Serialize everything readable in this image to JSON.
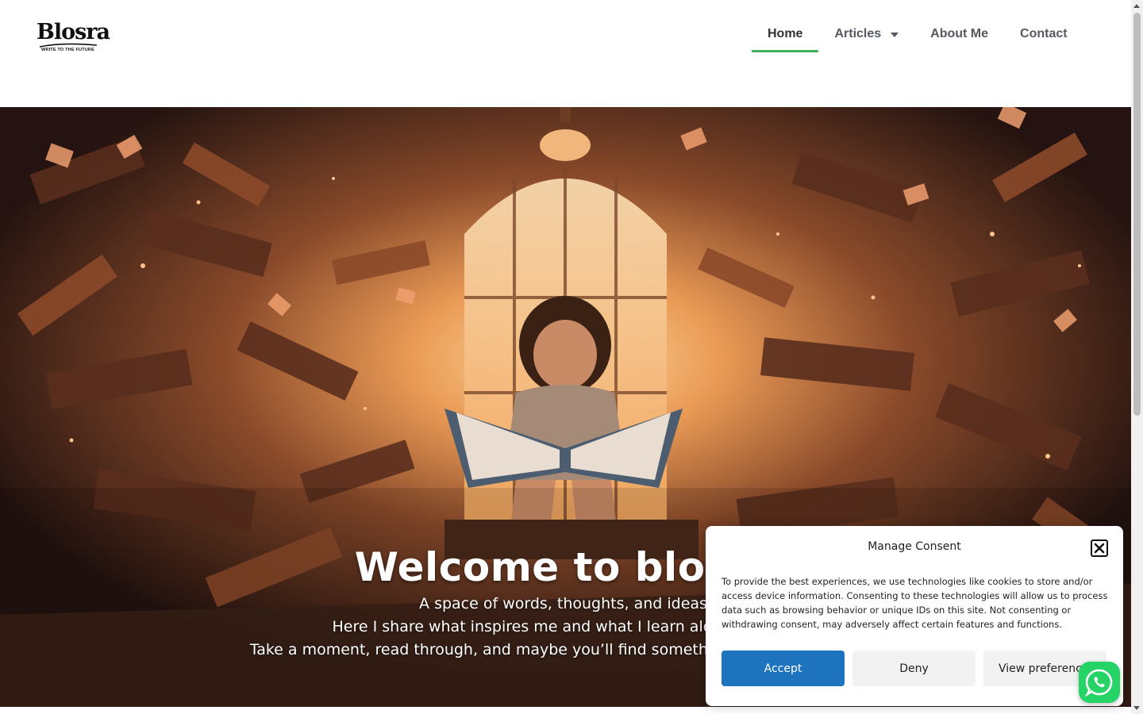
{
  "logo": {
    "wordmark": "Blosra",
    "tagline": "WRITE TO THE FUTURE"
  },
  "nav": {
    "items": [
      {
        "label": "Home",
        "active": true
      },
      {
        "label": "Articles",
        "has_dropdown": true
      },
      {
        "label": "About Me"
      },
      {
        "label": "Contact"
      }
    ]
  },
  "hero": {
    "title": "Welcome to blosra",
    "lines": [
      "A space of words, thoughts, and ideas.",
      "Here I share what inspires me and what I learn along the way.",
      "Take a moment, read through, and maybe you’ll find something that speaks to you."
    ]
  },
  "consent": {
    "title": "Manage Consent",
    "body": "To provide the best experiences, we use technologies like cookies to store and/or access device information. Consenting to these technologies will allow us to process data such as browsing behavior or unique IDs on this site. Not consenting or withdrawing consent, may adversely affect certain features and functions.",
    "accept_label": "Accept",
    "deny_label": "Deny",
    "preferences_label": "View preferences",
    "accent_color": "#1e73be"
  },
  "colors": {
    "nav_active_underline": "#3fb15a",
    "whatsapp": "#25d366"
  },
  "icons": {
    "close": "close-icon",
    "whatsapp": "whatsapp-icon",
    "dropdown": "caret-down-icon"
  }
}
